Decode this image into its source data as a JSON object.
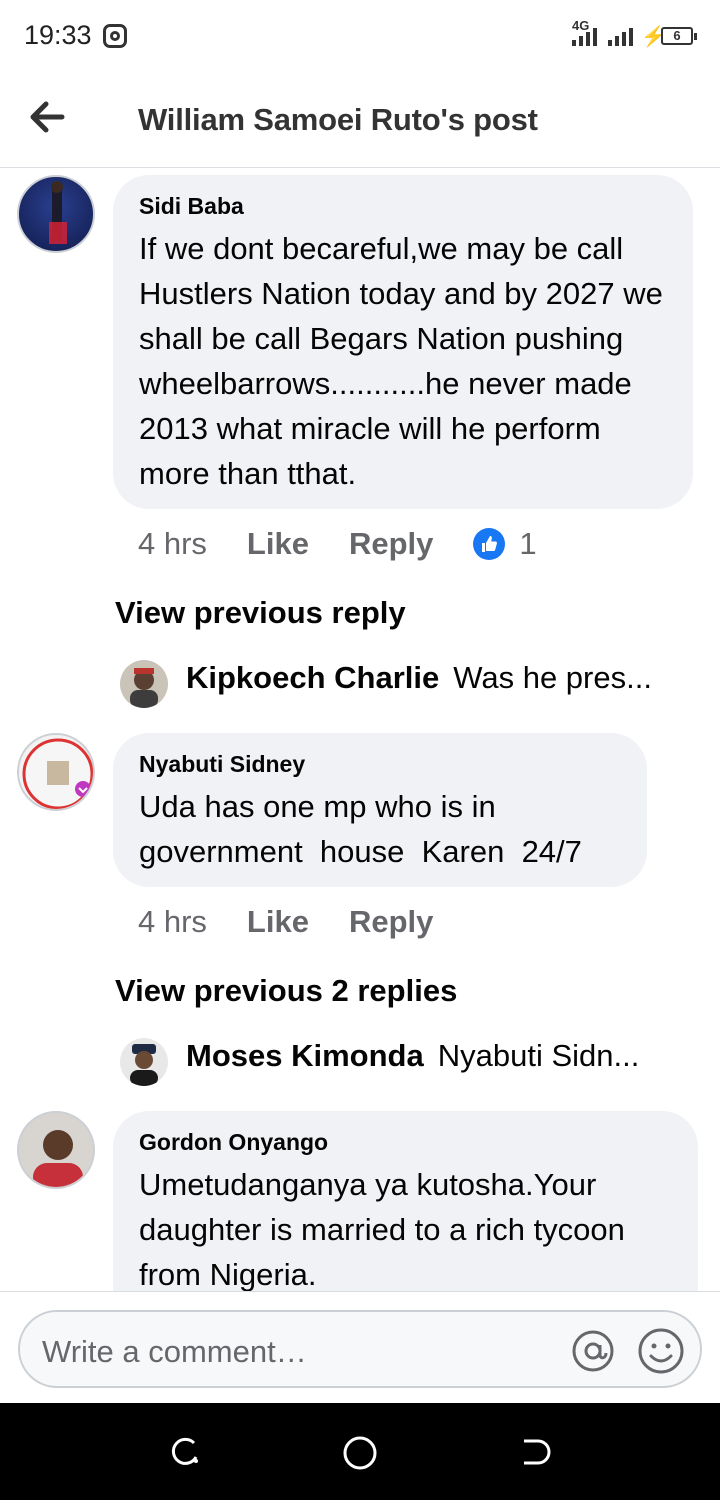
{
  "status_bar": {
    "time": "19:33",
    "network": "4G",
    "battery": "6"
  },
  "header": {
    "title": "William Samoei Ruto's post"
  },
  "comments": [
    {
      "author": "Sidi Baba",
      "text": "If we dont becareful,we may be call Hustlers Nation today and by 2027 we shall be call Begars Nation pushing wheelbarrows...........he never made 2013 what miracle will he perform more than tthat.",
      "time": "4 hrs",
      "like_label": "Like",
      "reply_label": "Reply",
      "reaction_count": "1"
    },
    {
      "author": "Nyabuti Sidney",
      "text": "Uda has one mp who is in government  house  Karen  24/7",
      "time": "4 hrs",
      "like_label": "Like",
      "reply_label": "Reply"
    },
    {
      "author": "Gordon Onyango",
      "text": "Umetudanganya ya kutosha.Your daughter is married to a rich tycoon from Nigeria."
    }
  ],
  "threads": [
    {
      "view_previous": "View previous reply",
      "reply_author": "Kipkoech Charlie",
      "reply_snippet": "Was he pres..."
    },
    {
      "view_previous": "View previous 2 replies",
      "reply_author": "Moses Kimonda",
      "reply_snippet": "Nyabuti Sidn..."
    }
  ],
  "composer": {
    "placeholder": "Write a comment…"
  },
  "colors": {
    "bubble": "#f0f2f5",
    "meta_text": "#65676b",
    "like_blue": "#1877f2"
  }
}
